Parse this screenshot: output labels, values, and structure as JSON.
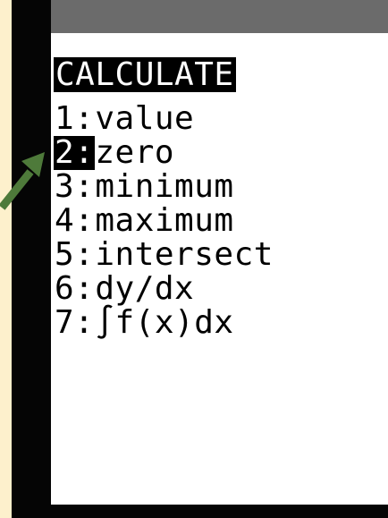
{
  "menu": {
    "title": "CALCULATE",
    "items": [
      {
        "number": "1:",
        "label": "value",
        "selected": false
      },
      {
        "number": "2:",
        "label": "zero",
        "selected": true
      },
      {
        "number": "3:",
        "label": "minimum",
        "selected": false
      },
      {
        "number": "4:",
        "label": "maximum",
        "selected": false
      },
      {
        "number": "5:",
        "label": "intersect",
        "selected": false
      },
      {
        "number": "6:",
        "label": "dy/dx",
        "selected": false
      },
      {
        "number": "7:",
        "label": "∫f(x)dx",
        "selected": false
      }
    ]
  },
  "colors": {
    "background": "#FDF0CC",
    "bezel": "#050505",
    "top_strip": "#6B6B6B",
    "screen": "#FFFFFF",
    "arrow": "#4E7A3A"
  },
  "icons": {
    "pointer": "green-arrow-icon"
  }
}
